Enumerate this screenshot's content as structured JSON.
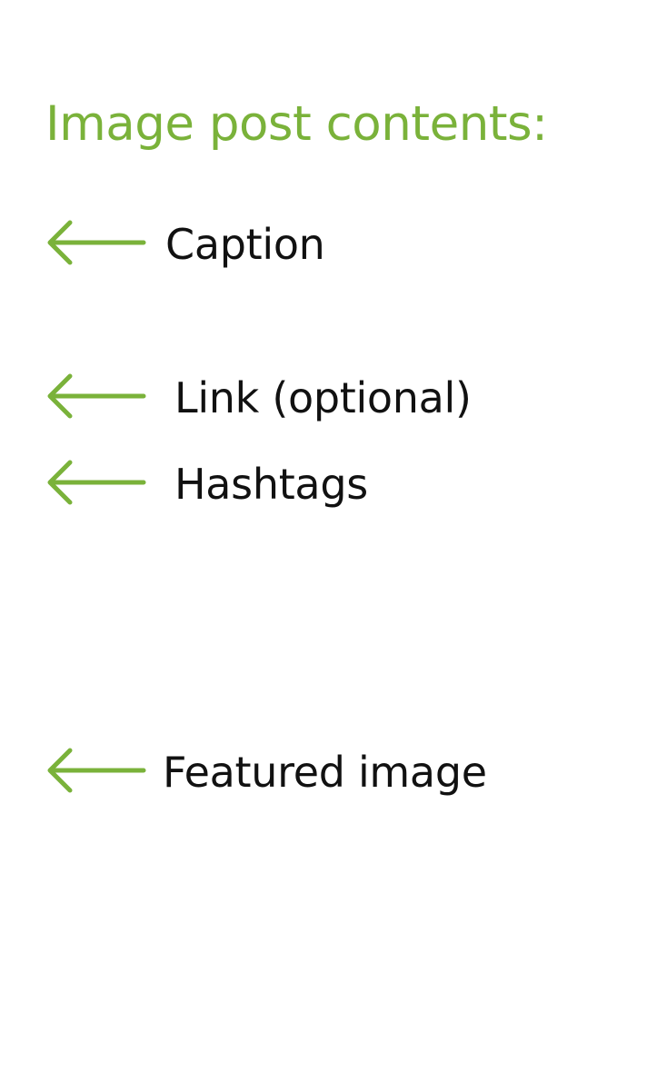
{
  "title": "Image post contents:",
  "colors": {
    "accent": "#7ab23a",
    "text": "#111111"
  },
  "items": [
    {
      "label": "Caption",
      "icon": "arrow-left-icon"
    },
    {
      "label": "Link (optional)",
      "icon": "arrow-left-icon"
    },
    {
      "label": "Hashtags",
      "icon": "arrow-left-icon"
    },
    {
      "label": "Featured image",
      "icon": "arrow-left-icon"
    }
  ]
}
